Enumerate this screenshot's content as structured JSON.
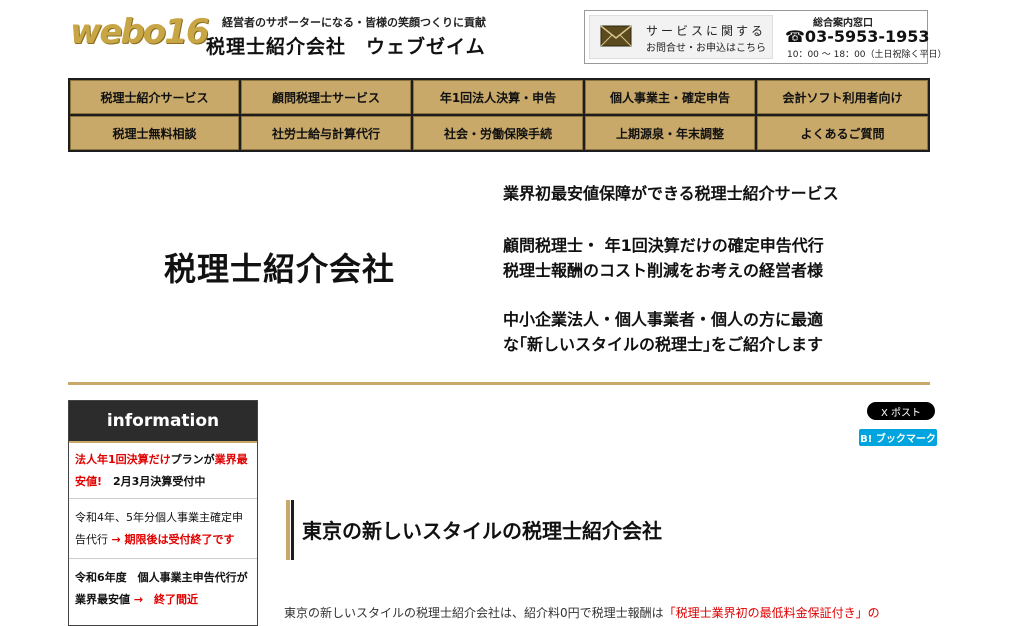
{
  "header": {
    "logo_text": "webo16",
    "tagline": "経営者のサポーターになる・皆様の笑顔つくりに貢献",
    "company_name": "税理士紹介会社　ウェブゼイム",
    "contact": {
      "service_line1": "サービスに関する",
      "service_line2": "お問合せ・お申込はこちら",
      "phone_label": "総合案内窓口",
      "phone_number": "☎03-5953-1953",
      "hours": "10：00 〜 18：00（土日祝除く平日）"
    }
  },
  "nav": {
    "row1": [
      "税理士紹介サービス",
      "顧問税理士サービス",
      "年1回法人決算・申告",
      "個人事業主・確定申告",
      "会計ソフト利用者向け"
    ],
    "row2": [
      "税理士無料相談",
      "社労士給与計算代行",
      "社会・労働保険手続",
      "上期源泉・年末調整",
      "よくあるご質問"
    ]
  },
  "hero": {
    "title": "税理士紹介会社",
    "lines": [
      "業界初最安値保障ができる税理士紹介サービス",
      "顧問税理士・ 年1回決算だけの確定申告代行",
      "税理士報酬のコスト削減をお考えの経営者様",
      "中小企業法人・個人事業者・個人の方に最適",
      "な｢新しいスタイルの税理士｣をご紹介します"
    ]
  },
  "sidebar": {
    "header": "information",
    "items": [
      {
        "red1": "法人年1回決算だけ",
        "black1": "プランが",
        "red2": "業界最安値!",
        "black2": "　2月3月決算受付中"
      },
      {
        "black1": "令和4年、5年分個人事業主確定申告代行 ",
        "red1": "→ 期限後は受付終了です"
      },
      {
        "black1": "令和6年度　個人事業主申告代行が業界最安値 ",
        "red1": "→　終了間近"
      }
    ]
  },
  "social": {
    "x_post": "X ポスト",
    "hatena": "B! ブックマーク"
  },
  "main": {
    "heading": "東京の新しいスタイルの税理士紹介会社",
    "body_black": "東京の新しいスタイルの税理士紹介会社は、紹介料0円で税理士報酬は",
    "body_red": "「税理士業界初の最低料金保証付き」の"
  }
}
